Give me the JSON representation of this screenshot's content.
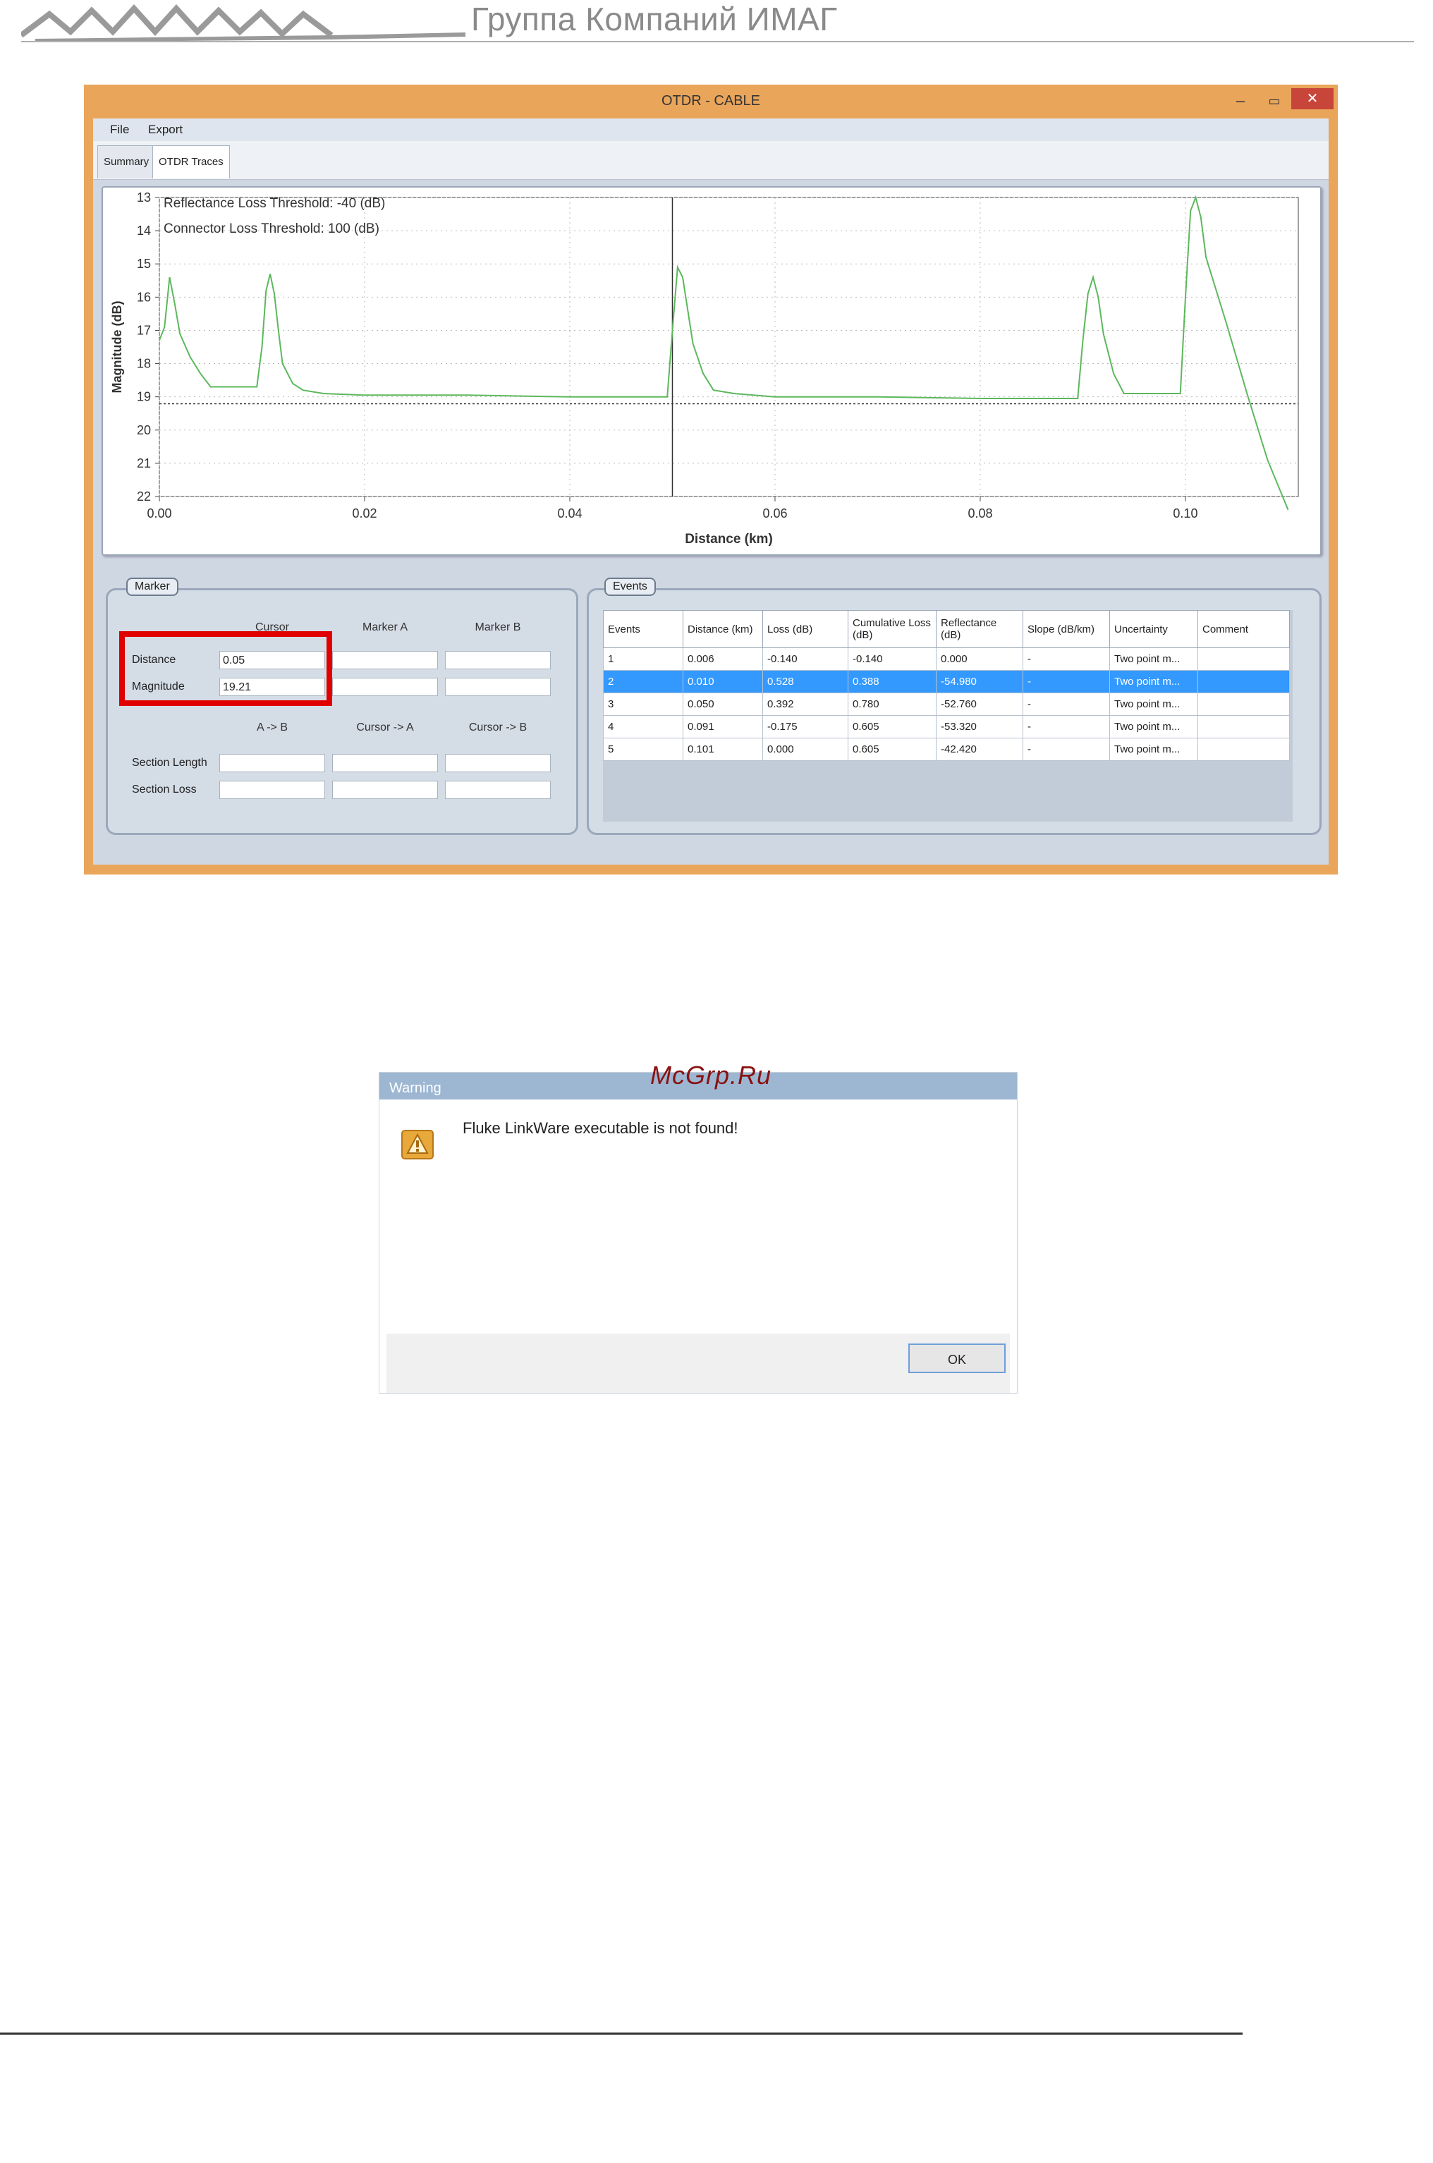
{
  "page": {
    "brand": "Группа Компаний ИМАГ"
  },
  "window": {
    "title": "OTDR - CABLE",
    "menu": [
      "File",
      "Export"
    ],
    "tabs": [
      {
        "label": "Summary",
        "active": false
      },
      {
        "label": "OTDR Traces",
        "active": true
      }
    ],
    "colors": {
      "trace": "#5cb85c",
      "selection": "#3399ff",
      "highlight_box": "#e00000",
      "close": "#c8453a"
    }
  },
  "chart_data": {
    "type": "line",
    "xlabel": "Distance (km)",
    "ylabel": "Magnitude (dB)",
    "xlim": [
      0.0,
      0.111
    ],
    "ylim": [
      13,
      22
    ],
    "y_inverted": true,
    "x_ticks": [
      "0.00",
      "0.02",
      "0.04",
      "0.06",
      "0.08",
      "0.10"
    ],
    "y_ticks": [
      "13",
      "14",
      "15",
      "16",
      "17",
      "18",
      "19",
      "20",
      "21",
      "22"
    ],
    "annotations": [
      "Reflectance Loss Threshold: -40 (dB)",
      "Connector Loss Threshold: 100 (dB)"
    ],
    "grid": true,
    "cursor_x": 0.05,
    "cursor_y": 19.21,
    "series": [
      {
        "x": [
          0.0,
          0.0005,
          0.001,
          0.0015,
          0.002,
          0.003,
          0.004,
          0.005,
          0.006,
          0.007,
          0.008,
          0.009,
          0.0095,
          0.01,
          0.0104,
          0.0108,
          0.0112,
          0.0116,
          0.012,
          0.013,
          0.014,
          0.016,
          0.02,
          0.03,
          0.04,
          0.0495,
          0.05,
          0.0505,
          0.051,
          0.0515,
          0.052,
          0.053,
          0.054,
          0.056,
          0.06,
          0.07,
          0.08,
          0.0895,
          0.09,
          0.0905,
          0.091,
          0.0915,
          0.092,
          0.093,
          0.094,
          0.0995,
          0.1,
          0.1005,
          0.101,
          0.1015,
          0.102,
          0.104,
          0.106,
          0.108,
          0.11
        ],
        "values": [
          17.3,
          16.9,
          15.4,
          16.2,
          17.1,
          17.8,
          18.3,
          18.7,
          18.7,
          18.7,
          18.7,
          18.7,
          18.7,
          17.5,
          15.8,
          15.3,
          15.9,
          17.0,
          18.0,
          18.6,
          18.8,
          18.9,
          18.95,
          18.95,
          19.0,
          19.0,
          17.0,
          15.1,
          15.4,
          16.4,
          17.4,
          18.3,
          18.8,
          18.9,
          19.0,
          19.0,
          19.05,
          19.05,
          17.3,
          15.9,
          15.4,
          16.0,
          17.1,
          18.3,
          18.9,
          18.9,
          16.0,
          13.4,
          13.0,
          13.6,
          14.8,
          16.8,
          18.9,
          20.9,
          22.4
        ]
      }
    ]
  },
  "marker": {
    "title": "Marker",
    "columns": [
      "Cursor",
      "Marker A",
      "Marker B"
    ],
    "rows": [
      {
        "label": "Distance",
        "values": [
          "0.05",
          "",
          ""
        ]
      },
      {
        "label": "Magnitude",
        "values": [
          "19.21",
          "",
          ""
        ]
      }
    ],
    "section_columns": [
      "A -> B",
      "Cursor -> A",
      "Cursor -> B"
    ],
    "section_rows": [
      {
        "label": "Section Length",
        "values": [
          "",
          "",
          ""
        ]
      },
      {
        "label": "Section Loss",
        "values": [
          "",
          "",
          ""
        ]
      }
    ]
  },
  "events": {
    "title": "Events",
    "headers": [
      "Events",
      "Distance (km)",
      "Loss (dB)",
      "Cumulative Loss (dB)",
      "Reflectance (dB)",
      "Slope (dB/km)",
      "Uncertainty",
      "Comment"
    ],
    "selected_index": 1,
    "rows": [
      [
        "1",
        "0.006",
        "-0.140",
        "-0.140",
        "0.000",
        "-",
        "Two point m...",
        ""
      ],
      [
        "2",
        "0.010",
        "0.528",
        "0.388",
        "-54.980",
        "-",
        "Two point m...",
        ""
      ],
      [
        "3",
        "0.050",
        "0.392",
        "0.780",
        "-52.760",
        "-",
        "Two point m...",
        ""
      ],
      [
        "4",
        "0.091",
        "-0.175",
        "0.605",
        "-53.320",
        "-",
        "Two point m...",
        ""
      ],
      [
        "5",
        "0.101",
        "0.000",
        "0.605",
        "-42.420",
        "-",
        "Two point m...",
        ""
      ]
    ]
  },
  "dialog": {
    "title": "Warning",
    "watermark": "McGrp.Ru",
    "icon": "warning-icon",
    "message": "Fluke LinkWare executable is not found!",
    "ok_label": "OK"
  }
}
